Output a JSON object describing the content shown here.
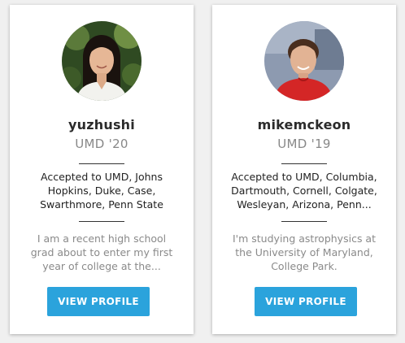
{
  "profiles": [
    {
      "username": "yuzhushi",
      "school": "UMD '20",
      "accepted": "Accepted to UMD, Johns\nHopkins, Duke, Case,\nSwarthmore, Penn State",
      "bio": "I am a recent high school\ngrad about to enter my first\nyear of college at the...",
      "button_label": "VIEW PROFILE"
    },
    {
      "username": "mikemckeon",
      "school": "UMD '19",
      "accepted": "Accepted to UMD, Columbia,\nDartmouth, Cornell, Colgate,\nWesleyan, Arizona, Penn...",
      "bio": "I'm studying astrophysics at\nthe University of Maryland,\nCollege Park.",
      "button_label": "VIEW PROFILE"
    }
  ],
  "colors": {
    "button": "#2ba3dc",
    "background": "#f0f0f0",
    "card": "#ffffff"
  }
}
